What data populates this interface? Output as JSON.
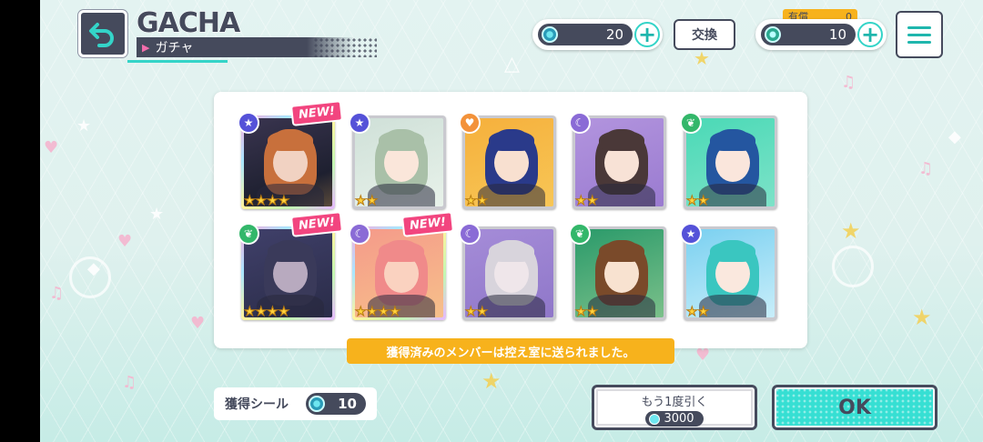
{
  "header": {
    "title_en": "GACHA",
    "title_jp": "ガチャ"
  },
  "currency": {
    "crystal_count": "20",
    "exchange_label": "交換",
    "paid_label": "有償",
    "paid_count": "0",
    "gem_count": "10"
  },
  "results": [
    {
      "attribute": "cool",
      "attr_icon": "★",
      "stars": "★★★★",
      "new": true
    },
    {
      "attribute": "cool",
      "attr_icon": "★",
      "stars": "★★",
      "new": false
    },
    {
      "attribute": "cute",
      "attr_icon": "♥",
      "stars": "★★",
      "new": false
    },
    {
      "attribute": "mysterious",
      "attr_icon": "☾",
      "stars": "★★",
      "new": false
    },
    {
      "attribute": "pure",
      "attr_icon": "❦",
      "stars": "★★",
      "new": false
    },
    {
      "attribute": "pure",
      "attr_icon": "❦",
      "stars": "★★★★",
      "new": true
    },
    {
      "attribute": "mysterious",
      "attr_icon": "☾",
      "stars": "★★★★",
      "new": true
    },
    {
      "attribute": "mysterious",
      "attr_icon": "☾",
      "stars": "★★",
      "new": false
    },
    {
      "attribute": "pure",
      "attr_icon": "❦",
      "stars": "★★",
      "new": false
    },
    {
      "attribute": "cool",
      "attr_icon": "★",
      "stars": "★★",
      "new": false
    }
  ],
  "new_badge": "NEW!",
  "notice": "獲得済みのメンバーは控え室に送られました。",
  "seals": {
    "label": "獲得シール",
    "count": "10"
  },
  "actions": {
    "again_label": "もう1度引く",
    "again_cost": "3000",
    "ok_label": "OK"
  },
  "colors": {
    "accent": "#36dfd3",
    "navy": "#454a5c",
    "notice": "#f7b21c",
    "new_badge": "#f2457f"
  }
}
